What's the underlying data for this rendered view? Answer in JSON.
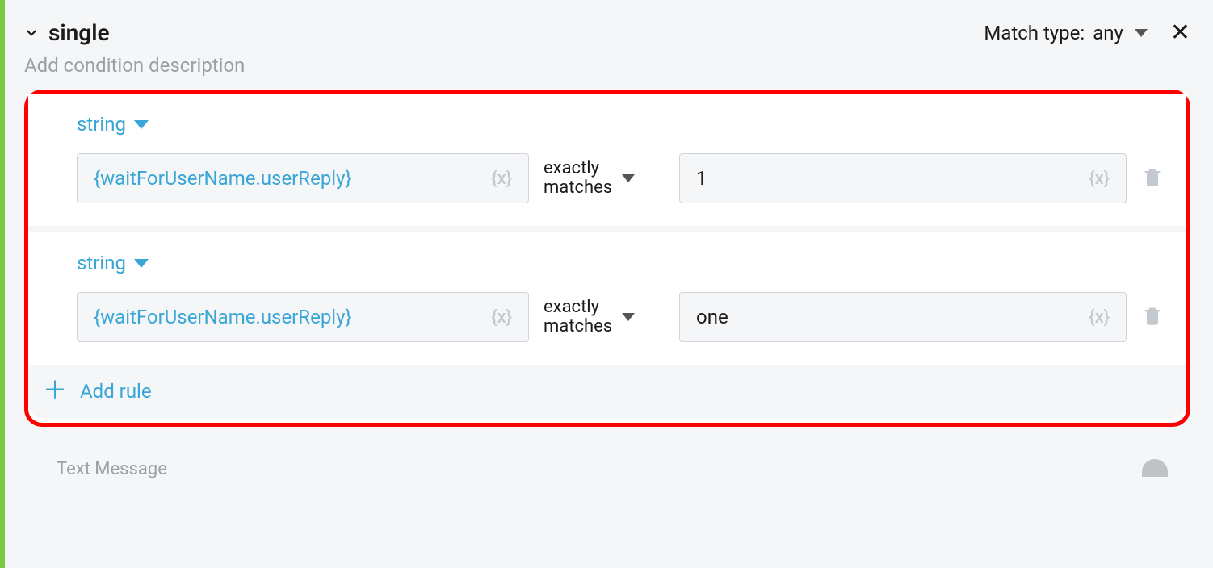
{
  "condition": {
    "title": "single",
    "description_placeholder": "Add condition description",
    "match_type_label": "Match type:",
    "match_type_value": "any"
  },
  "rules": [
    {
      "type_label": "string",
      "left_value": "{waitForUserName.userReply}",
      "operator_line1": "exactly",
      "operator_line2": "matches",
      "right_value": "1",
      "variable_icon": "{x}"
    },
    {
      "type_label": "string",
      "left_value": "{waitForUserName.userReply}",
      "operator_line1": "exactly",
      "operator_line2": "matches",
      "right_value": "one",
      "variable_icon": "{x}"
    }
  ],
  "actions": {
    "add_rule_label": "Add rule"
  },
  "footer": {
    "hint": "Text Message"
  }
}
